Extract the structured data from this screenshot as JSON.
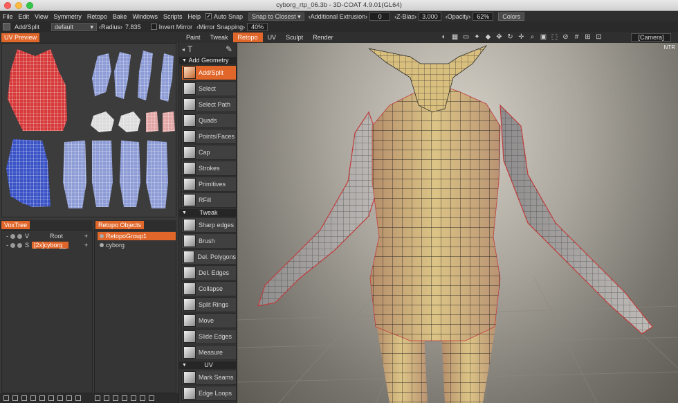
{
  "window": {
    "title": "cyborg_rtp_06.3b - 3D-COAT 4.9.01(GL64)"
  },
  "menu": [
    "File",
    "Edit",
    "View",
    "Symmetry",
    "Retopo",
    "Bake",
    "Windows",
    "Scripts",
    "Help"
  ],
  "options": {
    "auto_snap": "Auto Snap",
    "snap_mode": "Snap to Closest",
    "additional_extrusion_label": "Additional Extrusion",
    "additional_extrusion_value": "0",
    "zbias_label": "Z-Bias",
    "zbias_value": "3.000",
    "opacity_label": "Opacity",
    "opacity_value": "62%",
    "colors_label": "Colors"
  },
  "toolbar2": {
    "tool_name": "Add/Split",
    "preset": "default",
    "radius_label": "Radius",
    "radius_value": "7.835",
    "invert_mirror": "Invert Mirror",
    "mirror_snapping_label": "Mirror Snapping",
    "mirror_snapping_value": "40%"
  },
  "panels": {
    "uv_preview": "UV Preview",
    "voxtree": "VoxTree",
    "retopo_objects": "Retopo Objects"
  },
  "rooms": [
    "Paint",
    "Tweak",
    "Retopo",
    "UV",
    "Sculpt",
    "Render"
  ],
  "active_room": "Retopo",
  "camera": "[Camera]",
  "voxtree_rows": [
    {
      "mark": "V",
      "name": "Root"
    },
    {
      "mark": "S",
      "name": "[2x]cyborg_"
    }
  ],
  "retopo_objects": [
    "RetopoGroup1",
    "cyborg"
  ],
  "tool_sections": {
    "add_geometry": "Add Geometry",
    "tweak": "Tweak",
    "uv": "UV"
  },
  "tools": {
    "add_geometry": [
      "Add/Split",
      "Select",
      "Select Path",
      "Quads",
      "Points/Faces",
      "Cap",
      "Strokes",
      "Primitives",
      "RFill"
    ],
    "tweak": [
      "Sharp edges",
      "Brush",
      "Del. Polygons",
      "Del. Edges",
      "Collapse",
      "Split Rings",
      "Move",
      "Slide Edges",
      "Measure"
    ],
    "uv": [
      "Mark Seams",
      "Edge Loops"
    ]
  },
  "viewport_label": "NTR",
  "colors": {
    "accent": "#e0662a",
    "mesh": "#d8c07a"
  }
}
